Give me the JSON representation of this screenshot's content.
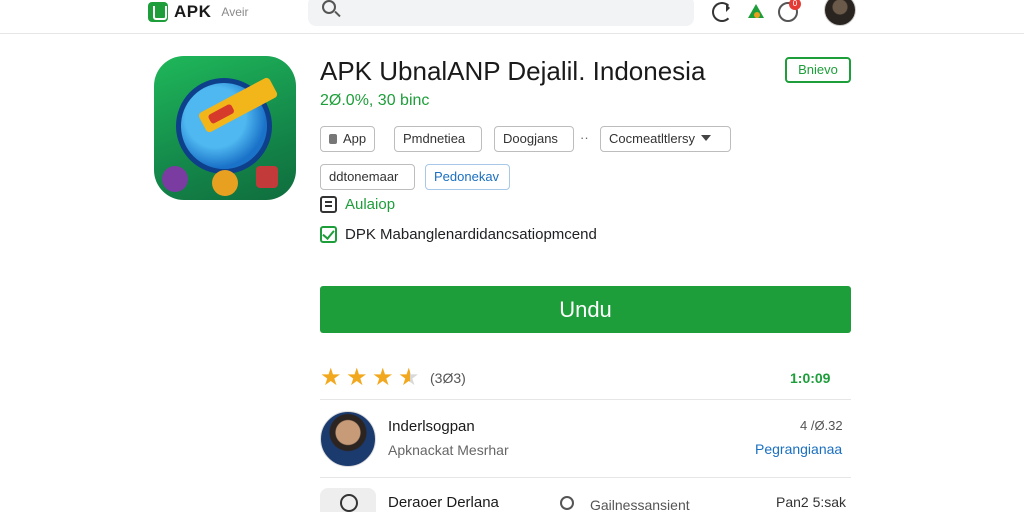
{
  "header": {
    "logo_text": "APK",
    "logo_sub": "Aveir",
    "notification_count": "0"
  },
  "app": {
    "title": "APK UbnalANP Dejalil. Indonesia",
    "subtitle": "2Ø.0%, 30 binc",
    "follow_label": "Bnievo",
    "chips": {
      "app": "App",
      "c2": "Pmdnetiea",
      "c3": "Doogjans",
      "dots": "··",
      "dropdown": "Cocmeatltlersy",
      "c5": "ddtonemaar",
      "c6": "Pedonekav"
    },
    "check1": "Aulaiop",
    "check2": "DPK Mabanglenardidancsatiopmcend",
    "download_label": "Undu"
  },
  "rating": {
    "stars": 3.5,
    "count": "(3Ø3)",
    "right": "1:0:09"
  },
  "developer": {
    "name": "Inderlsogpan",
    "sub": "Apknackat Mesrhar",
    "date": "4 /Ø.32",
    "link": "Pegrangianaa"
  },
  "bottom": {
    "name": "Deraoer Derlana",
    "middle": "Gailnessansient",
    "right": "Pan2 5:sak"
  },
  "colors": {
    "accent": "#1e9e3a",
    "link": "#1a6fc0",
    "star": "#f2a81e"
  }
}
